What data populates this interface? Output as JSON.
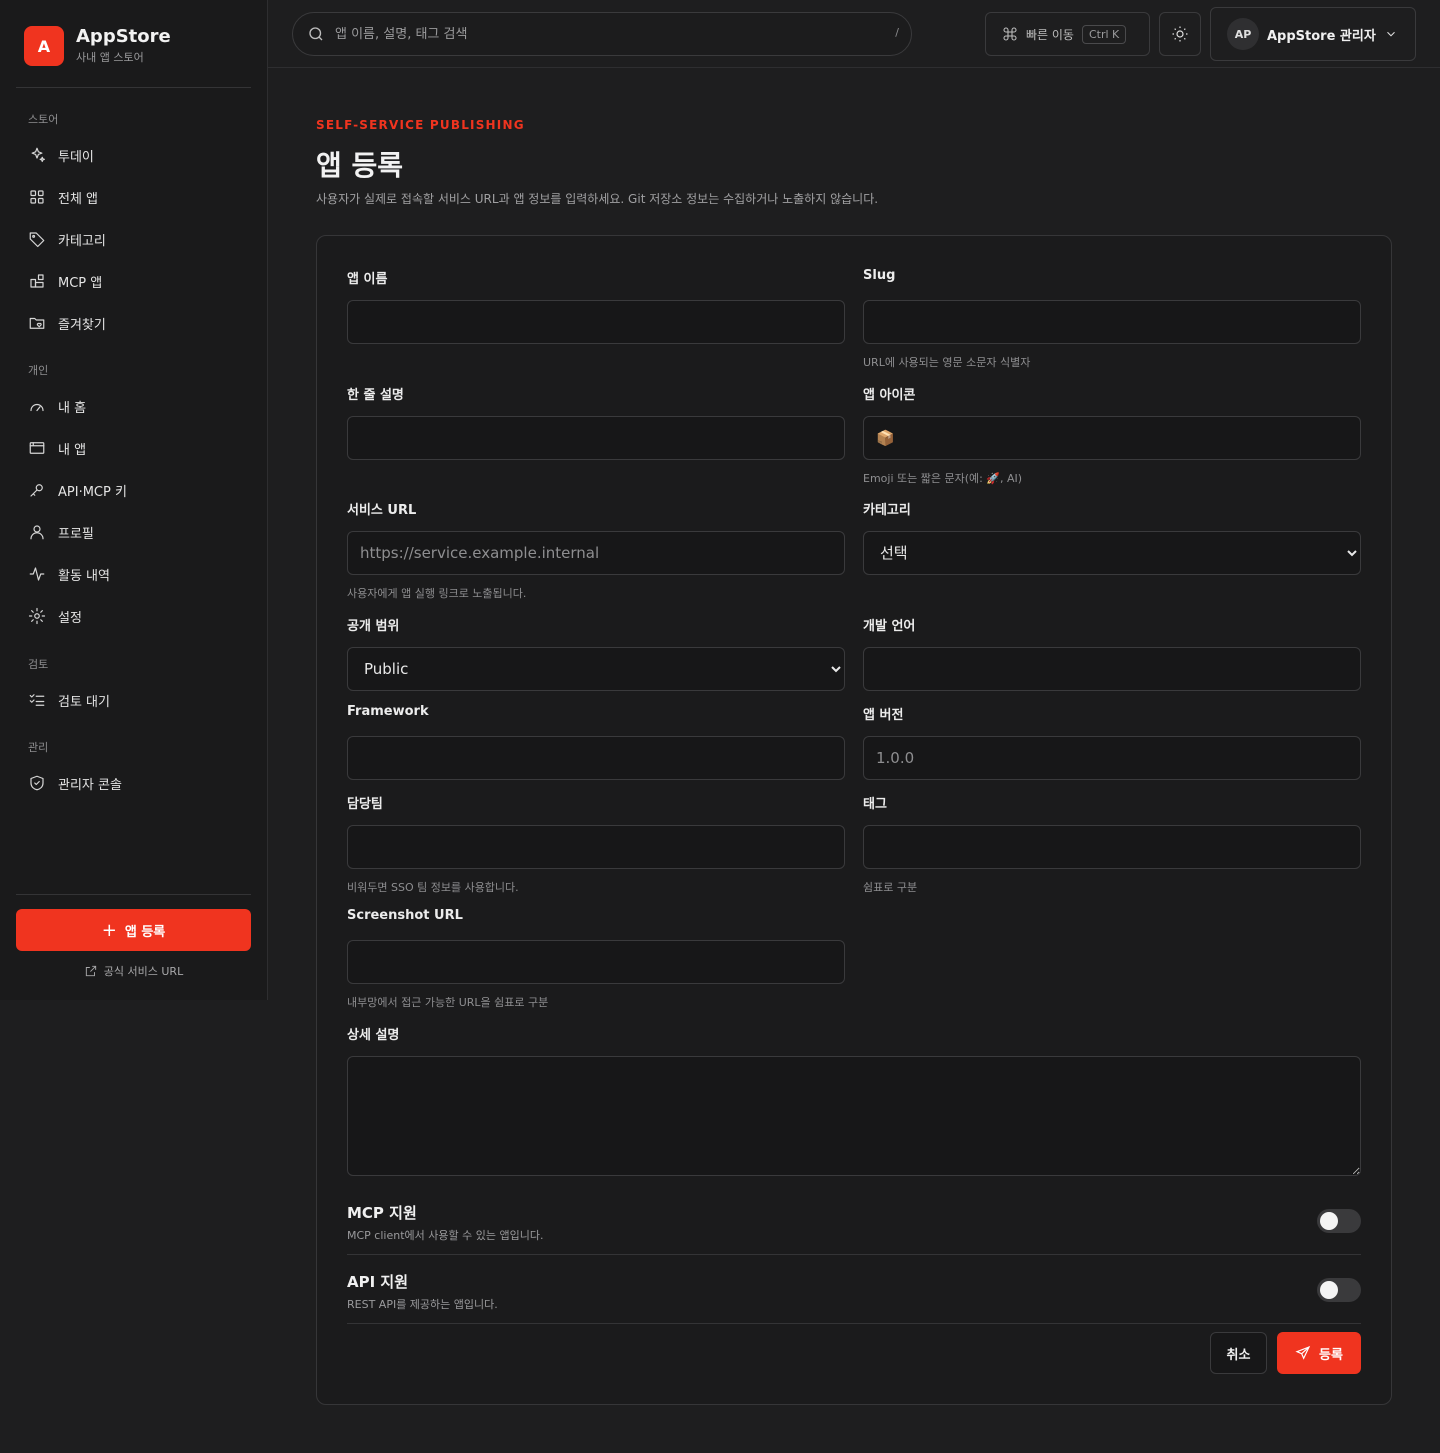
{
  "brand": {
    "logo_letter": "A",
    "title": "AppStore",
    "subtitle": "사내 앱 스토어"
  },
  "sidebar": {
    "sections": [
      {
        "label": "스토어",
        "items": [
          {
            "label": "투데이",
            "icon": "sparkles-icon"
          },
          {
            "label": "전체 앱",
            "icon": "grid-icon"
          },
          {
            "label": "카테고리",
            "icon": "tag-icon"
          },
          {
            "label": "MCP 앱",
            "icon": "blocks-icon"
          },
          {
            "label": "즐겨찾기",
            "icon": "folder-heart-icon"
          }
        ]
      },
      {
        "label": "개인",
        "items": [
          {
            "label": "내 홈",
            "icon": "gauge-icon"
          },
          {
            "label": "내 앱",
            "icon": "window-icon"
          },
          {
            "label": "API·MCP 키",
            "icon": "key-icon"
          },
          {
            "label": "프로필",
            "icon": "user-icon"
          },
          {
            "label": "활동 내역",
            "icon": "activity-icon"
          },
          {
            "label": "설정",
            "icon": "gear-icon"
          }
        ]
      },
      {
        "label": "검토",
        "items": [
          {
            "label": "검토 대기",
            "icon": "list-check-icon"
          }
        ]
      },
      {
        "label": "관리",
        "items": [
          {
            "label": "관리자 콘솔",
            "icon": "shield-check-icon"
          }
        ]
      }
    ],
    "cta_label": "앱 등록",
    "cta_plus": "+",
    "footer_link": "공식 서비스 URL"
  },
  "topbar": {
    "search_placeholder": "앱 이름, 설명, 태그 검색",
    "search_shortcut": "/",
    "quick_label": "빠른 이동",
    "quick_kbd": "Ctrl K",
    "user_initials": "AP",
    "user_name": "AppStore 관리자"
  },
  "page": {
    "eyebrow": "SELF-SERVICE PUBLISHING",
    "title": "앱 등록",
    "description": "사용자가 실제로 접속할 서비스 URL과 앱 정보를 입력하세요. Git 저장소 정보는 수집하거나 노출하지 않습니다."
  },
  "form": {
    "app_name": {
      "label": "앱 이름",
      "value": "",
      "placeholder": ""
    },
    "slug": {
      "label": "Slug",
      "value": "",
      "placeholder": "",
      "hint": "URL에 사용되는 영문 소문자 식별자"
    },
    "short_desc": {
      "label": "한 줄 설명",
      "value": "",
      "placeholder": ""
    },
    "app_icon": {
      "label": "앱 아이콘",
      "value": "📦",
      "placeholder": "",
      "hint": "Emoji 또는 짧은 문자(예: 🚀, AI)"
    },
    "service_url": {
      "label": "서비스 URL",
      "value": "",
      "placeholder": "https://service.example.internal",
      "hint": "사용자에게 앱 실행 링크로 노출됩니다."
    },
    "category": {
      "label": "카테고리",
      "selected": "선택"
    },
    "visibility": {
      "label": "공개 범위",
      "selected": "Public"
    },
    "language": {
      "label": "개발 언어",
      "value": "",
      "placeholder": ""
    },
    "framework": {
      "label": "Framework",
      "value": "",
      "placeholder": ""
    },
    "version": {
      "label": "앱 버전",
      "value": "",
      "placeholder": "1.0.0"
    },
    "team": {
      "label": "담당팀",
      "value": "",
      "placeholder": "",
      "hint": "비워두면 SSO 팀 정보를 사용합니다."
    },
    "tags": {
      "label": "태그",
      "value": "",
      "placeholder": "",
      "hint": "쉼표로 구분"
    },
    "screenshot_url": {
      "label": "Screenshot URL",
      "value": "",
      "placeholder": "",
      "hint": "내부망에서 접근 가능한 URL을 쉼표로 구분"
    },
    "detail_desc": {
      "label": "상세 설명",
      "value": ""
    },
    "mcp": {
      "title": "MCP 지원",
      "desc": "MCP client에서 사용할 수 있는 앱입니다.",
      "enabled": false
    },
    "api": {
      "title": "API 지원",
      "desc": "REST API를 제공하는 앱입니다.",
      "enabled": false
    },
    "cancel_label": "취소",
    "submit_label": "등록"
  }
}
